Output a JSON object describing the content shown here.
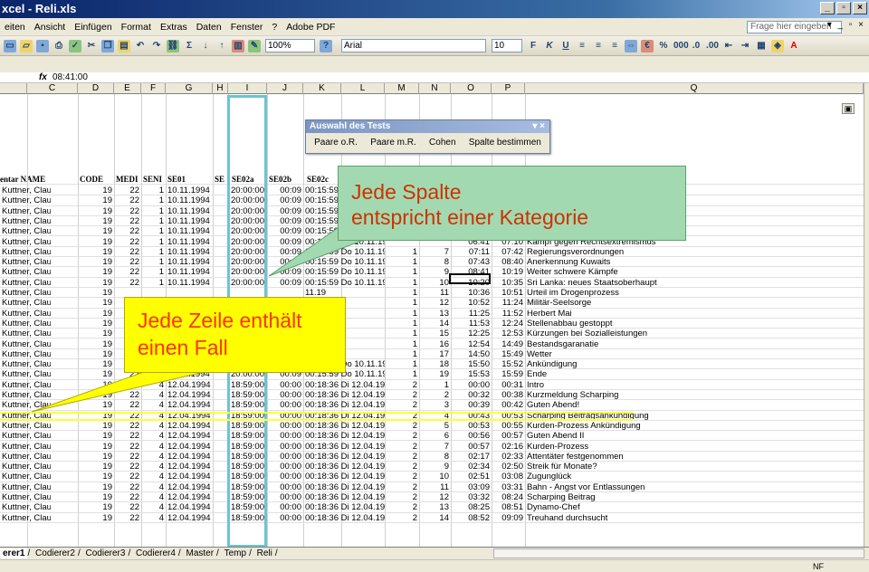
{
  "titlebar": {
    "title": "xcel - Reli.xls"
  },
  "menu": [
    "eiten",
    "Ansicht",
    "Einfügen",
    "Format",
    "Extras",
    "Daten",
    "Fenster",
    "?",
    "Adobe PDF"
  ],
  "help_placeholder": "Frage hier eingeben",
  "toolbar": {
    "zoom": "100%",
    "font": "Arial",
    "size": "10"
  },
  "formula_bar": {
    "cell": "",
    "fx": "fx",
    "value": "08:41:00"
  },
  "columns": [
    "C",
    "D",
    "E",
    "F",
    "G",
    "H",
    "I",
    "J",
    "K",
    "L",
    "M",
    "N",
    "O",
    "P",
    "Q"
  ],
  "header_row": [
    "entar NAME",
    "CODE",
    "MEDI",
    "SENI",
    "SE01",
    "SE",
    "SE02a",
    "SE02b",
    "SE02c"
  ],
  "auswahl": {
    "title": "Auswahl des Tests",
    "buttons": [
      "Paare o.R.",
      "Paare m.R.",
      "Cohen",
      "Spalte bestimmen"
    ]
  },
  "callout_green": {
    "line1": "Jede Spalte",
    "line2": "entspricht einer Kategorie"
  },
  "callout_yellow": {
    "line1": "Jede Zeile enthält",
    "line2": "einen Fall"
  },
  "rows": [
    [
      "Kuttner, Clau",
      "19",
      "22",
      "1",
      "10.11.1994",
      "",
      "20:00:00",
      "00:09",
      "00:15:59 Do 10.11.19",
      "",
      "",
      "",
      "",
      ""
    ],
    [
      "Kuttner, Clau",
      "19",
      "22",
      "1",
      "10.11.1994",
      "",
      "20:00:00",
      "00:09",
      "00:15:59 Do 10.11.19",
      "",
      "",
      "",
      "",
      ""
    ],
    [
      "Kuttner, Clau",
      "19",
      "22",
      "1",
      "10.11.1994",
      "",
      "20:00:00",
      "00:09",
      "00:15:59 Do 10.11.19",
      "",
      "",
      "",
      "",
      ""
    ],
    [
      "Kuttner, Clau",
      "19",
      "22",
      "1",
      "10.11.1994",
      "",
      "20:00:00",
      "00:09",
      "00:15:59 Do 10.11.19",
      "",
      "",
      "",
      "",
      ""
    ],
    [
      "Kuttner, Clau",
      "19",
      "22",
      "1",
      "10.11.1994",
      "",
      "20:00:00",
      "00:09",
      "00:15:59 Do 10.11.19",
      "",
      "",
      "",
      "",
      ""
    ],
    [
      "Kuttner, Clau",
      "19",
      "22",
      "1",
      "10.11.1994",
      "",
      "20:00:00",
      "00:09",
      "00:15:59 Do 10.11.19",
      "",
      "",
      "06:41",
      "07:10",
      "Kampf gegen Rechtsextremismus"
    ],
    [
      "Kuttner, Clau",
      "19",
      "22",
      "1",
      "10.11.1994",
      "",
      "20:00:00",
      "00:09",
      "00:15:59 Do 10.11.19",
      "1",
      "7",
      "07:11",
      "07:42",
      "Regierungsverordnungen"
    ],
    [
      "Kuttner, Clau",
      "19",
      "22",
      "1",
      "10.11.1994",
      "",
      "20:00:00",
      "00:09",
      "00:15:59 Do 10.11.19",
      "1",
      "8",
      "07:43",
      "08:40",
      "Anerkennung Kuwaits"
    ],
    [
      "Kuttner, Clau",
      "19",
      "22",
      "1",
      "10.11.1994",
      "",
      "20:00:00",
      "00:09",
      "00:15:59 Do 10.11.19",
      "1",
      "9",
      "08:41",
      "10:19",
      "Weiter schwere Kämpfe"
    ],
    [
      "Kuttner, Clau",
      "19",
      "22",
      "1",
      "10.11.1994",
      "",
      "20:00:00",
      "00:09",
      "00:15:59 Do 10.11.19",
      "1",
      "10",
      "10:20",
      "10:35",
      "Sri Lanka: neues Staatsoberhaupt"
    ],
    [
      "Kuttner, Clau",
      "19",
      "",
      "",
      "",
      "",
      "",
      "",
      "11.19",
      "1",
      "11",
      "10:36",
      "10:51",
      "Urteil im Drogenprozess"
    ],
    [
      "Kuttner, Clau",
      "19",
      "",
      "",
      "",
      "",
      "",
      "",
      "11.19",
      "1",
      "12",
      "10:52",
      "11:24",
      "Militär-Seelsorge"
    ],
    [
      "Kuttner, Clau",
      "19",
      "",
      "",
      "",
      "",
      "",
      "",
      "11.19",
      "1",
      "13",
      "11:25",
      "11:52",
      "Herbert Mai"
    ],
    [
      "Kuttner, Clau",
      "19",
      "",
      "",
      "",
      "",
      "",
      "",
      "11.19",
      "1",
      "14",
      "11:53",
      "12:24",
      "Stellenabbau gestoppt"
    ],
    [
      "Kuttner, Clau",
      "19",
      "",
      "",
      "",
      "",
      "",
      "",
      "11.19",
      "1",
      "15",
      "12:25",
      "12:53",
      "Kürzungen bei Sozialleistungen"
    ],
    [
      "Kuttner, Clau",
      "19",
      "",
      "",
      "",
      "",
      "",
      "",
      "11.19",
      "1",
      "16",
      "12:54",
      "14:49",
      "Bestandsgaranatie"
    ],
    [
      "Kuttner, Clau",
      "19",
      "",
      "",
      "",
      "",
      "",
      "",
      "11.19",
      "1",
      "17",
      "14:50",
      "15:49",
      "Wetter"
    ],
    [
      "Kuttner, Clau",
      "19",
      "22",
      "1",
      "10.11.1994",
      "",
      "20:00:00",
      "00:09",
      "00:15:59 Do 10.11.19",
      "1",
      "18",
      "15:50",
      "15:52",
      "Ankündigung"
    ],
    [
      "Kuttner, Clau",
      "19",
      "22",
      "1",
      "10.11.1994",
      "",
      "20:00:00",
      "00:09",
      "00:15:59 Do 10.11.19",
      "1",
      "19",
      "15:53",
      "15:59",
      "Ende"
    ],
    [
      "Kuttner, Clau",
      "19",
      "22",
      "4",
      "12.04.1994",
      "",
      "18:59:00",
      "00:00",
      "00:18:36 Di 12.04.19",
      "2",
      "1",
      "00:00",
      "00:31",
      "Intro"
    ],
    [
      "Kuttner, Clau",
      "19",
      "22",
      "4",
      "12.04.1994",
      "",
      "18:59:00",
      "00:00",
      "00:18:36 Di 12.04.19",
      "2",
      "2",
      "00:32",
      "00:38",
      "Kurzmeldung Scharping"
    ],
    [
      "Kuttner, Clau",
      "19",
      "22",
      "4",
      "12.04.1994",
      "",
      "18:59:00",
      "00:00",
      "00:18:36 Di 12.04.19",
      "2",
      "3",
      "00:39",
      "00:42",
      "Guten Abend!"
    ],
    [
      "Kuttner, Clau",
      "19",
      "22",
      "4",
      "12.04.1994",
      "",
      "18:59:00",
      "00:00",
      "00:18:36 Di 12.04.19",
      "2",
      "4",
      "00:43",
      "00:53",
      "Scharping Beitragsankündigung"
    ],
    [
      "Kuttner, Clau",
      "19",
      "22",
      "4",
      "12.04.1994",
      "",
      "18:59:00",
      "00:00",
      "00:18:36 Di 12.04.19",
      "2",
      "5",
      "00:53",
      "00:55",
      "Kurden-Prozess Ankündigung"
    ],
    [
      "Kuttner, Clau",
      "19",
      "22",
      "4",
      "12.04.1994",
      "",
      "18:59:00",
      "00:00",
      "00:18:36 Di 12.04.19",
      "2",
      "6",
      "00:56",
      "00:57",
      "Guten Abend II"
    ],
    [
      "Kuttner, Clau",
      "19",
      "22",
      "4",
      "12.04.1994",
      "",
      "18:59:00",
      "00:00",
      "00:18:36 Di 12.04.19",
      "2",
      "7",
      "00:57",
      "02:16",
      "Kurden-Prozess"
    ],
    [
      "Kuttner, Clau",
      "19",
      "22",
      "4",
      "12.04.1994",
      "",
      "18:59:00",
      "00:00",
      "00:18:36 Di 12.04.19",
      "2",
      "8",
      "02:17",
      "02:33",
      "Attentäter festgenommen"
    ],
    [
      "Kuttner, Clau",
      "19",
      "22",
      "4",
      "12.04.1994",
      "",
      "18:59:00",
      "00:00",
      "00:18:36 Di 12.04.19",
      "2",
      "9",
      "02:34",
      "02:50",
      "Streik für Monate?"
    ],
    [
      "Kuttner, Clau",
      "19",
      "22",
      "4",
      "12.04.1994",
      "",
      "18:59:00",
      "00:00",
      "00:18:36 Di 12.04.19",
      "2",
      "10",
      "02:51",
      "03:08",
      "Zugunglück"
    ],
    [
      "Kuttner, Clau",
      "19",
      "22",
      "4",
      "12.04.1994",
      "",
      "18:59:00",
      "00:00",
      "00:18:36 Di 12.04.19",
      "2",
      "11",
      "03:09",
      "03:31",
      "Bahn - Angst vor Entlassungen"
    ],
    [
      "Kuttner, Clau",
      "19",
      "22",
      "4",
      "12.04.1994",
      "",
      "18:59:00",
      "00:00",
      "00:18:36 Di 12.04.19",
      "2",
      "12",
      "03:32",
      "08:24",
      "Scharping Beitrag"
    ],
    [
      "Kuttner, Clau",
      "19",
      "22",
      "4",
      "12.04.1994",
      "",
      "18:59:00",
      "00:00",
      "00:18:36 Di 12.04.19",
      "2",
      "13",
      "08:25",
      "08:51",
      "Dynamo-Chef"
    ],
    [
      "Kuttner, Clau",
      "19",
      "22",
      "4",
      "12.04.1994",
      "",
      "18:59:00",
      "00:00",
      "00:18:36 Di 12.04.19",
      "2",
      "14",
      "08:52",
      "09:09",
      "Treuhand durchsucht"
    ]
  ],
  "sheet_tabs": [
    "erer1",
    "Codierer2",
    "Codierer3",
    "Codierer4",
    "Master",
    "Temp",
    "Reli"
  ],
  "status": {
    "right": "NF"
  }
}
